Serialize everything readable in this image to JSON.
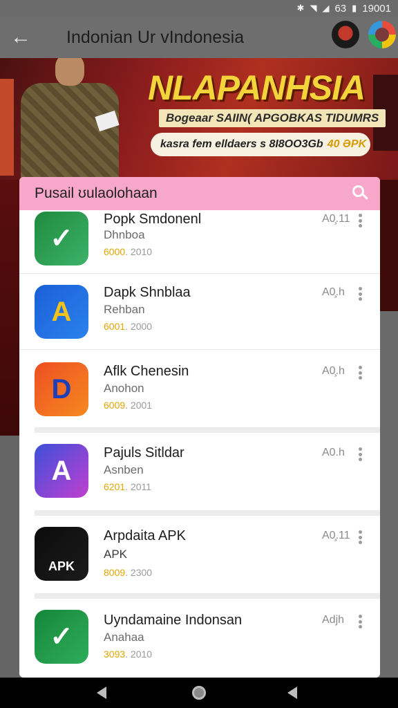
{
  "status_bar": {
    "icons": [
      "bluetooth-icon",
      "wifi-icon",
      "signal-icon",
      "battery-icon"
    ],
    "indicator": "63",
    "time": "19001"
  },
  "app_bar": {
    "title": "Indonian Ur vIndonesia"
  },
  "banner": {
    "headline": "NLAPANHSIA",
    "subheadline": "Bogeaar SAIIN( APGOBKAS TIDUMRS",
    "pill_text": "kasra fem elldaers s 8I8OO3Gb",
    "pill_highlight": "40 ƏPK"
  },
  "search": {
    "label": "Pusail ʊulaolohaan",
    "icon": "search-icon"
  },
  "apps": [
    {
      "title": "Popk Smdonenl",
      "subtitle": "Dhnboa",
      "meta_num": "6000",
      "meta_rest": ". 2010",
      "badge": "A0̧.11",
      "icon_colors": [
        "#1f8a3c",
        "#3db36a"
      ],
      "icon_glyph": "✓"
    },
    {
      "title": "Dapk Shnblaa",
      "subtitle": "Rehban",
      "meta_num": "6001",
      "meta_rest": ". 2000",
      "badge": "A0̧.h",
      "icon_colors": [
        "#1a5fd6",
        "#2b82ee"
      ],
      "icon_glyph": "A"
    },
    {
      "title": "Aflk Chenesin",
      "subtitle": "Anohon",
      "meta_num": "6009",
      "meta_rest": ". 2001",
      "badge": "A0̧.h",
      "icon_colors": [
        "#ee4e23",
        "#f58a1f"
      ],
      "icon_glyph": "D"
    },
    {
      "title": "Pajuls Sitldar",
      "subtitle": "Asnben",
      "meta_num": "6201",
      "meta_rest": ". 2011",
      "badge": "A0.h",
      "icon_colors": [
        "#3b4fd9",
        "#c13fcf"
      ],
      "icon_glyph": "A"
    },
    {
      "title": "Arpdaita APK",
      "subtitle": "APK",
      "meta_num": "8009",
      "meta_rest": ". 2300",
      "badge": "A0̧.11",
      "icon_colors": [
        "#0c0c0c",
        "#1b1b1b"
      ],
      "icon_glyph": "APK"
    },
    {
      "title": "Uyndamaine Indonsan",
      "subtitle": "Anahaa",
      "meta_num": "3093",
      "meta_rest": ". 2010",
      "badge": "Adjh",
      "icon_colors": [
        "#16863a",
        "#2fae5a"
      ],
      "icon_glyph": "✓"
    }
  ],
  "nav": {
    "back": "nav-back-icon",
    "home": "nav-home-icon",
    "recent": "nav-recent-icon"
  }
}
